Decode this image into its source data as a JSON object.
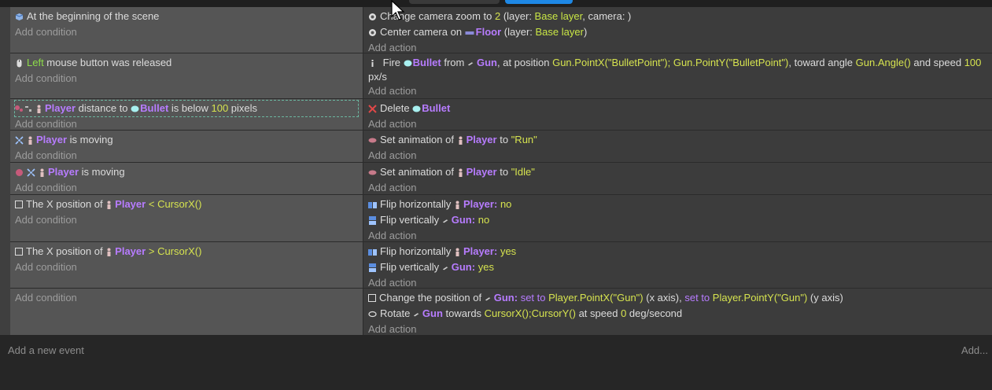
{
  "events": [
    {
      "conditions": [
        {
          "icon": "scene-icon",
          "text": "At the beginning of the scene"
        }
      ],
      "add_condition": "Add condition",
      "actions": [
        {
          "icon": "camera-icon",
          "text": "Change camera zoom to 2 (layer: Base layer, camera: )"
        },
        {
          "icon": "camera-icon",
          "text": "Center camera on Floor (layer: Base layer)"
        }
      ],
      "add_action": "Add action"
    },
    {
      "conditions": [
        {
          "icon": "mouse-icon",
          "text": "Left mouse button was released"
        }
      ],
      "add_condition": "Add condition",
      "actions": [
        {
          "icon": "fire-icon",
          "text": "Fire Bullet from Gun, at position Gun.PointX(\"BulletPoint\"); Gun.PointY(\"BulletPoint\"), toward angle Gun.Angle() and speed 100 px/s"
        }
      ],
      "add_action": "Add action"
    },
    {
      "conditions": [
        {
          "icon": "distance-icon",
          "text": "Player distance to Bullet is below 100 pixels"
        }
      ],
      "add_condition": "Add condition",
      "actions": [
        {
          "icon": "delete-icon",
          "text": "Delete Bullet"
        }
      ],
      "add_action": "Add action"
    },
    {
      "conditions": [
        {
          "icon": "moving-icon",
          "text": "Player is moving"
        }
      ],
      "add_condition": "Add condition",
      "actions": [
        {
          "icon": "animation-icon",
          "text": "Set animation of Player to \"Run\""
        }
      ],
      "add_action": "Add action"
    },
    {
      "conditions": [
        {
          "icon": "not-moving-icon",
          "text": "Player is moving"
        }
      ],
      "add_condition": "Add condition",
      "actions": [
        {
          "icon": "animation-icon",
          "text": "Set animation of Player to \"Idle\""
        }
      ],
      "add_action": "Add action"
    },
    {
      "conditions": [
        {
          "icon": "checkbox",
          "text": "The X position of Player < CursorX()"
        }
      ],
      "add_condition": "Add condition",
      "actions": [
        {
          "icon": "flip-h-icon",
          "text": "Flip horizontally Player: no"
        },
        {
          "icon": "flip-v-icon",
          "text": "Flip vertically Gun: no"
        }
      ],
      "add_action": "Add action"
    },
    {
      "conditions": [
        {
          "icon": "checkbox",
          "text": "The X position of Player > CursorX()"
        }
      ],
      "add_condition": "Add condition",
      "actions": [
        {
          "icon": "flip-h-icon",
          "text": "Flip horizontally Player: yes"
        },
        {
          "icon": "flip-v-icon",
          "text": "Flip vertically Gun: yes"
        }
      ],
      "add_action": "Add action"
    },
    {
      "conditions": [],
      "add_condition": "Add condition",
      "actions": [
        {
          "icon": "position-icon",
          "text": "Change the position of Gun: set to Player.PointX(\"Gun\") (x axis), set to Player.PointY(\"Gun\") (y axis)"
        },
        {
          "icon": "rotate-icon",
          "text": "Rotate Gun towards CursorX();CursorY() at speed 0 deg/second"
        }
      ],
      "add_action": "Add action"
    }
  ],
  "footer": {
    "add_event": "Add a new event",
    "add_more": "Add..."
  },
  "colors": {
    "object": "#b77cff",
    "value": "#d6e34f",
    "layer": "#c9e645",
    "selection": "#6bb6a0"
  }
}
